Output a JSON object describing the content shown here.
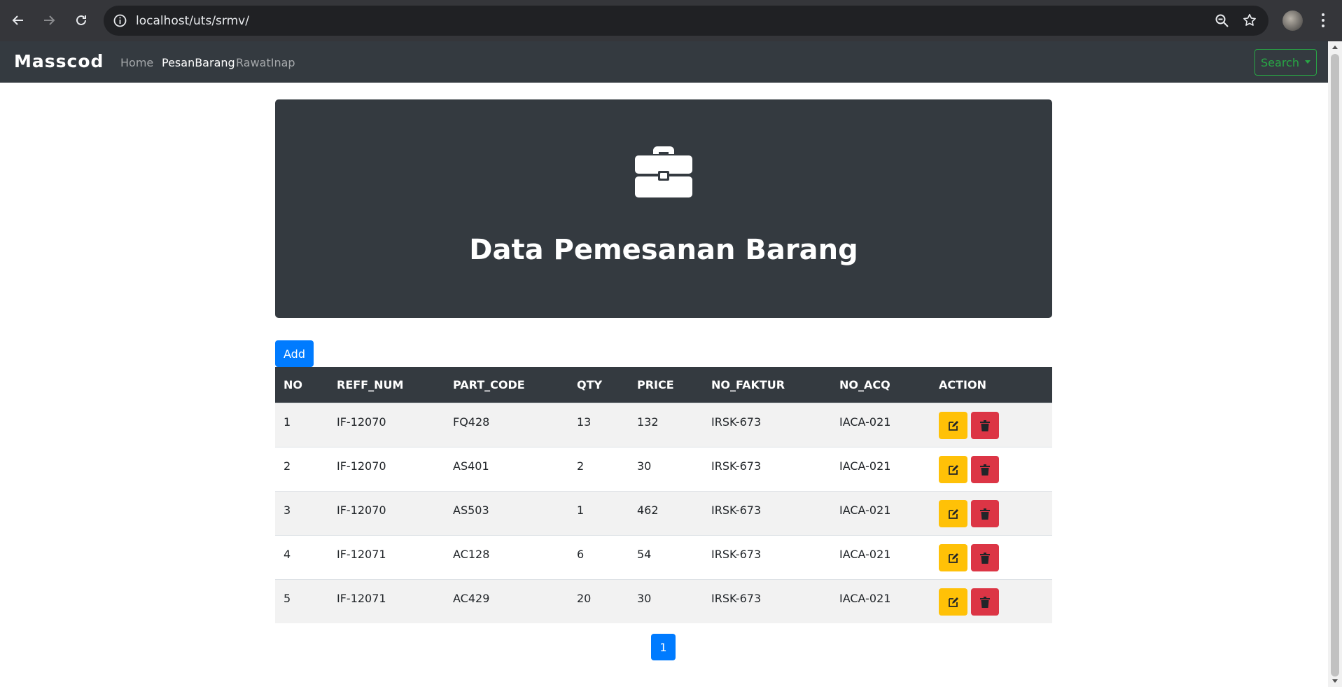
{
  "browser": {
    "url": "localhost/uts/srmv/"
  },
  "navbar": {
    "brand": "Masscod",
    "links": [
      {
        "label": "Home"
      },
      {
        "label": "PesanBarang"
      },
      {
        "label": "RawatInap"
      }
    ],
    "search_label": "Search"
  },
  "jumbotron": {
    "icon": "briefcase-icon",
    "title": "Data Pemesanan Barang"
  },
  "add_label": "Add",
  "table": {
    "headers": [
      "NO",
      "REFF_NUM",
      "PART_CODE",
      "QTY",
      "PRICE",
      "NO_FAKTUR",
      "NO_ACQ",
      "ACTION"
    ],
    "rows": [
      [
        "1",
        "IF-12070",
        "FQ428",
        "13",
        "132",
        "IRSK-673",
        "IACA-021"
      ],
      [
        "2",
        "IF-12070",
        "AS401",
        "2",
        "30",
        "IRSK-673",
        "IACA-021"
      ],
      [
        "3",
        "IF-12070",
        "AS503",
        "1",
        "462",
        "IRSK-673",
        "IACA-021"
      ],
      [
        "4",
        "IF-12071",
        "AC128",
        "6",
        "54",
        "IRSK-673",
        "IACA-021"
      ],
      [
        "5",
        "IF-12071",
        "AC429",
        "20",
        "30",
        "IRSK-673",
        "IACA-021"
      ]
    ]
  },
  "pagination": {
    "current": "1"
  },
  "colors": {
    "dark": "#343a40",
    "primary": "#007bff",
    "warning": "#ffc107",
    "danger": "#dc3545",
    "success": "#28a745"
  }
}
